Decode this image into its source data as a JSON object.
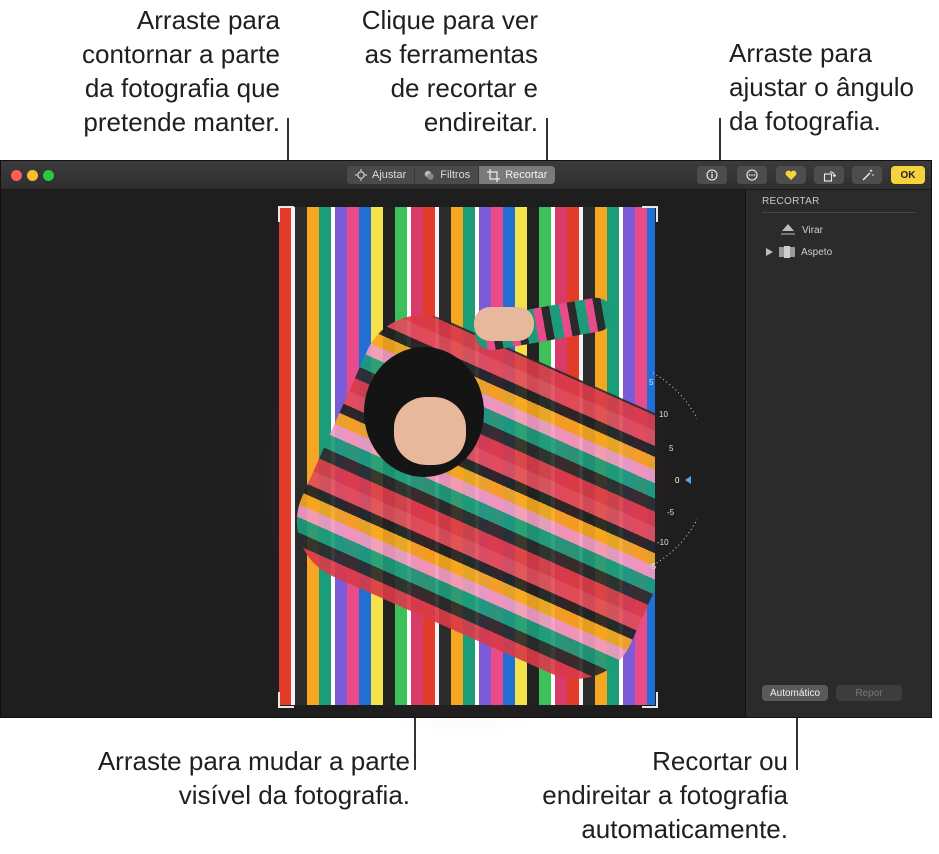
{
  "callouts": {
    "crop_edges": "Arraste para\ncontornar a parte\nda fotografia que\npretende manter.",
    "crop_tools": "Clique para ver\nas ferramentas\nde recortar e\nendireitar.",
    "angle": "Arraste para\najustar o ângulo\nda fotografia.",
    "move_visible": "Arraste para mudar a parte\nvisível da fotografia.",
    "auto": "Recortar ou\nendireitar a fotografia\nautomaticamente."
  },
  "toolbar": {
    "tabs": [
      {
        "label": "Ajustar",
        "icon": "adjust-icon",
        "active": false
      },
      {
        "label": "Filtros",
        "icon": "filters-icon",
        "active": false
      },
      {
        "label": "Recortar",
        "icon": "crop-icon",
        "active": true
      }
    ],
    "buttons": [
      {
        "name": "info-button",
        "icon": "info-icon"
      },
      {
        "name": "more-button",
        "icon": "ellipsis-icon"
      },
      {
        "name": "favorite-button",
        "icon": "heart-icon"
      },
      {
        "name": "rotate-button",
        "icon": "rotate-icon"
      },
      {
        "name": "enhance-button",
        "icon": "magic-wand-icon"
      }
    ],
    "ok_label": "OK"
  },
  "dial": {
    "ticks": [
      "5",
      "10",
      "5",
      "0",
      "-5",
      "-10",
      "-5"
    ]
  },
  "sidebar": {
    "title": "RECORTAR",
    "items": [
      {
        "label": "Virar",
        "icon": "flip-icon"
      },
      {
        "label": "Aspeto",
        "icon": "aspect-icon"
      }
    ],
    "auto_label": "Automático",
    "reset_label": "Repor"
  },
  "colors": {
    "accent_ok": "#f7d33b",
    "favorite": "#f7d33b",
    "window_bg": "#1e1e1e",
    "sidebar_bg": "#2b2b2b"
  }
}
